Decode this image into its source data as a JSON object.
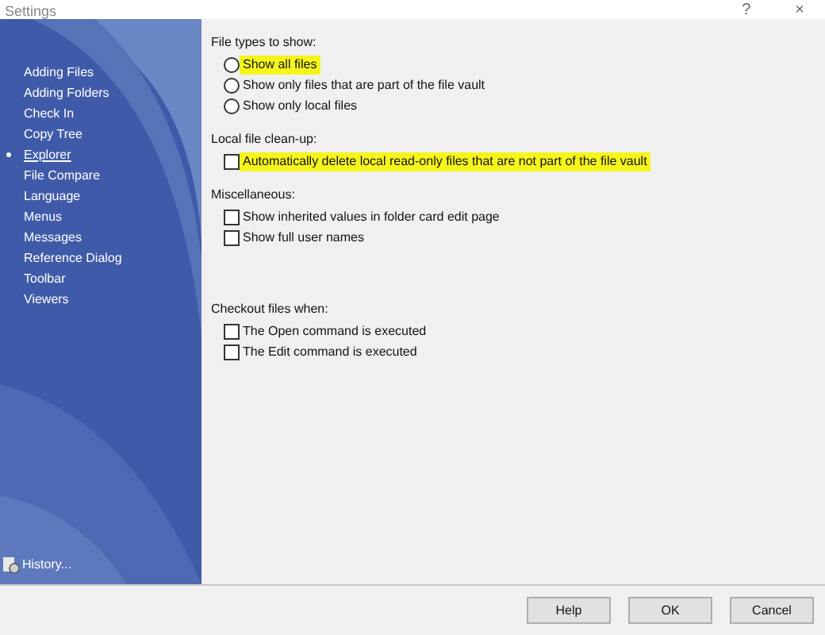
{
  "window": {
    "title": "Settings",
    "help_button": "?",
    "close_button": "×"
  },
  "sidebar": {
    "items": [
      {
        "label": "Adding Files",
        "selected": false
      },
      {
        "label": "Adding Folders",
        "selected": false
      },
      {
        "label": "Check In",
        "selected": false
      },
      {
        "label": "Copy Tree",
        "selected": false
      },
      {
        "label": "Explorer",
        "selected": true
      },
      {
        "label": "File Compare",
        "selected": false
      },
      {
        "label": "Language",
        "selected": false
      },
      {
        "label": "Menus",
        "selected": false
      },
      {
        "label": "Messages",
        "selected": false
      },
      {
        "label": "Reference Dialog",
        "selected": false
      },
      {
        "label": "Toolbar",
        "selected": false
      },
      {
        "label": "Viewers",
        "selected": false
      }
    ],
    "history_link": "History..."
  },
  "sections": [
    {
      "title": "File types to show:",
      "options": [
        {
          "kind": "radio",
          "label": "Show all files",
          "selected": false,
          "highlighted": true
        },
        {
          "kind": "radio",
          "label": "Show only files that are part of the file vault",
          "selected": false,
          "highlighted": false
        },
        {
          "kind": "radio",
          "label": "Show only local files",
          "selected": false,
          "highlighted": false
        }
      ]
    },
    {
      "title": "Local file clean-up:",
      "options": [
        {
          "kind": "checkbox",
          "label": "Automatically delete local read-only files that are not part of the file vault",
          "checked": false,
          "highlighted": true
        }
      ]
    },
    {
      "title": "Miscellaneous:",
      "options": [
        {
          "kind": "checkbox",
          "label": "Show inherited values in folder card edit page",
          "checked": false,
          "highlighted": false
        },
        {
          "kind": "checkbox",
          "label": "Show full user names",
          "checked": false,
          "highlighted": false
        }
      ]
    },
    {
      "title": "Checkout files when:",
      "options": [
        {
          "kind": "checkbox",
          "label": "The Open command is executed",
          "checked": false,
          "highlighted": false
        },
        {
          "kind": "checkbox",
          "label": "The Edit command is executed",
          "checked": false,
          "highlighted": false
        }
      ]
    }
  ],
  "buttons": [
    "Help",
    "OK",
    "Cancel"
  ]
}
